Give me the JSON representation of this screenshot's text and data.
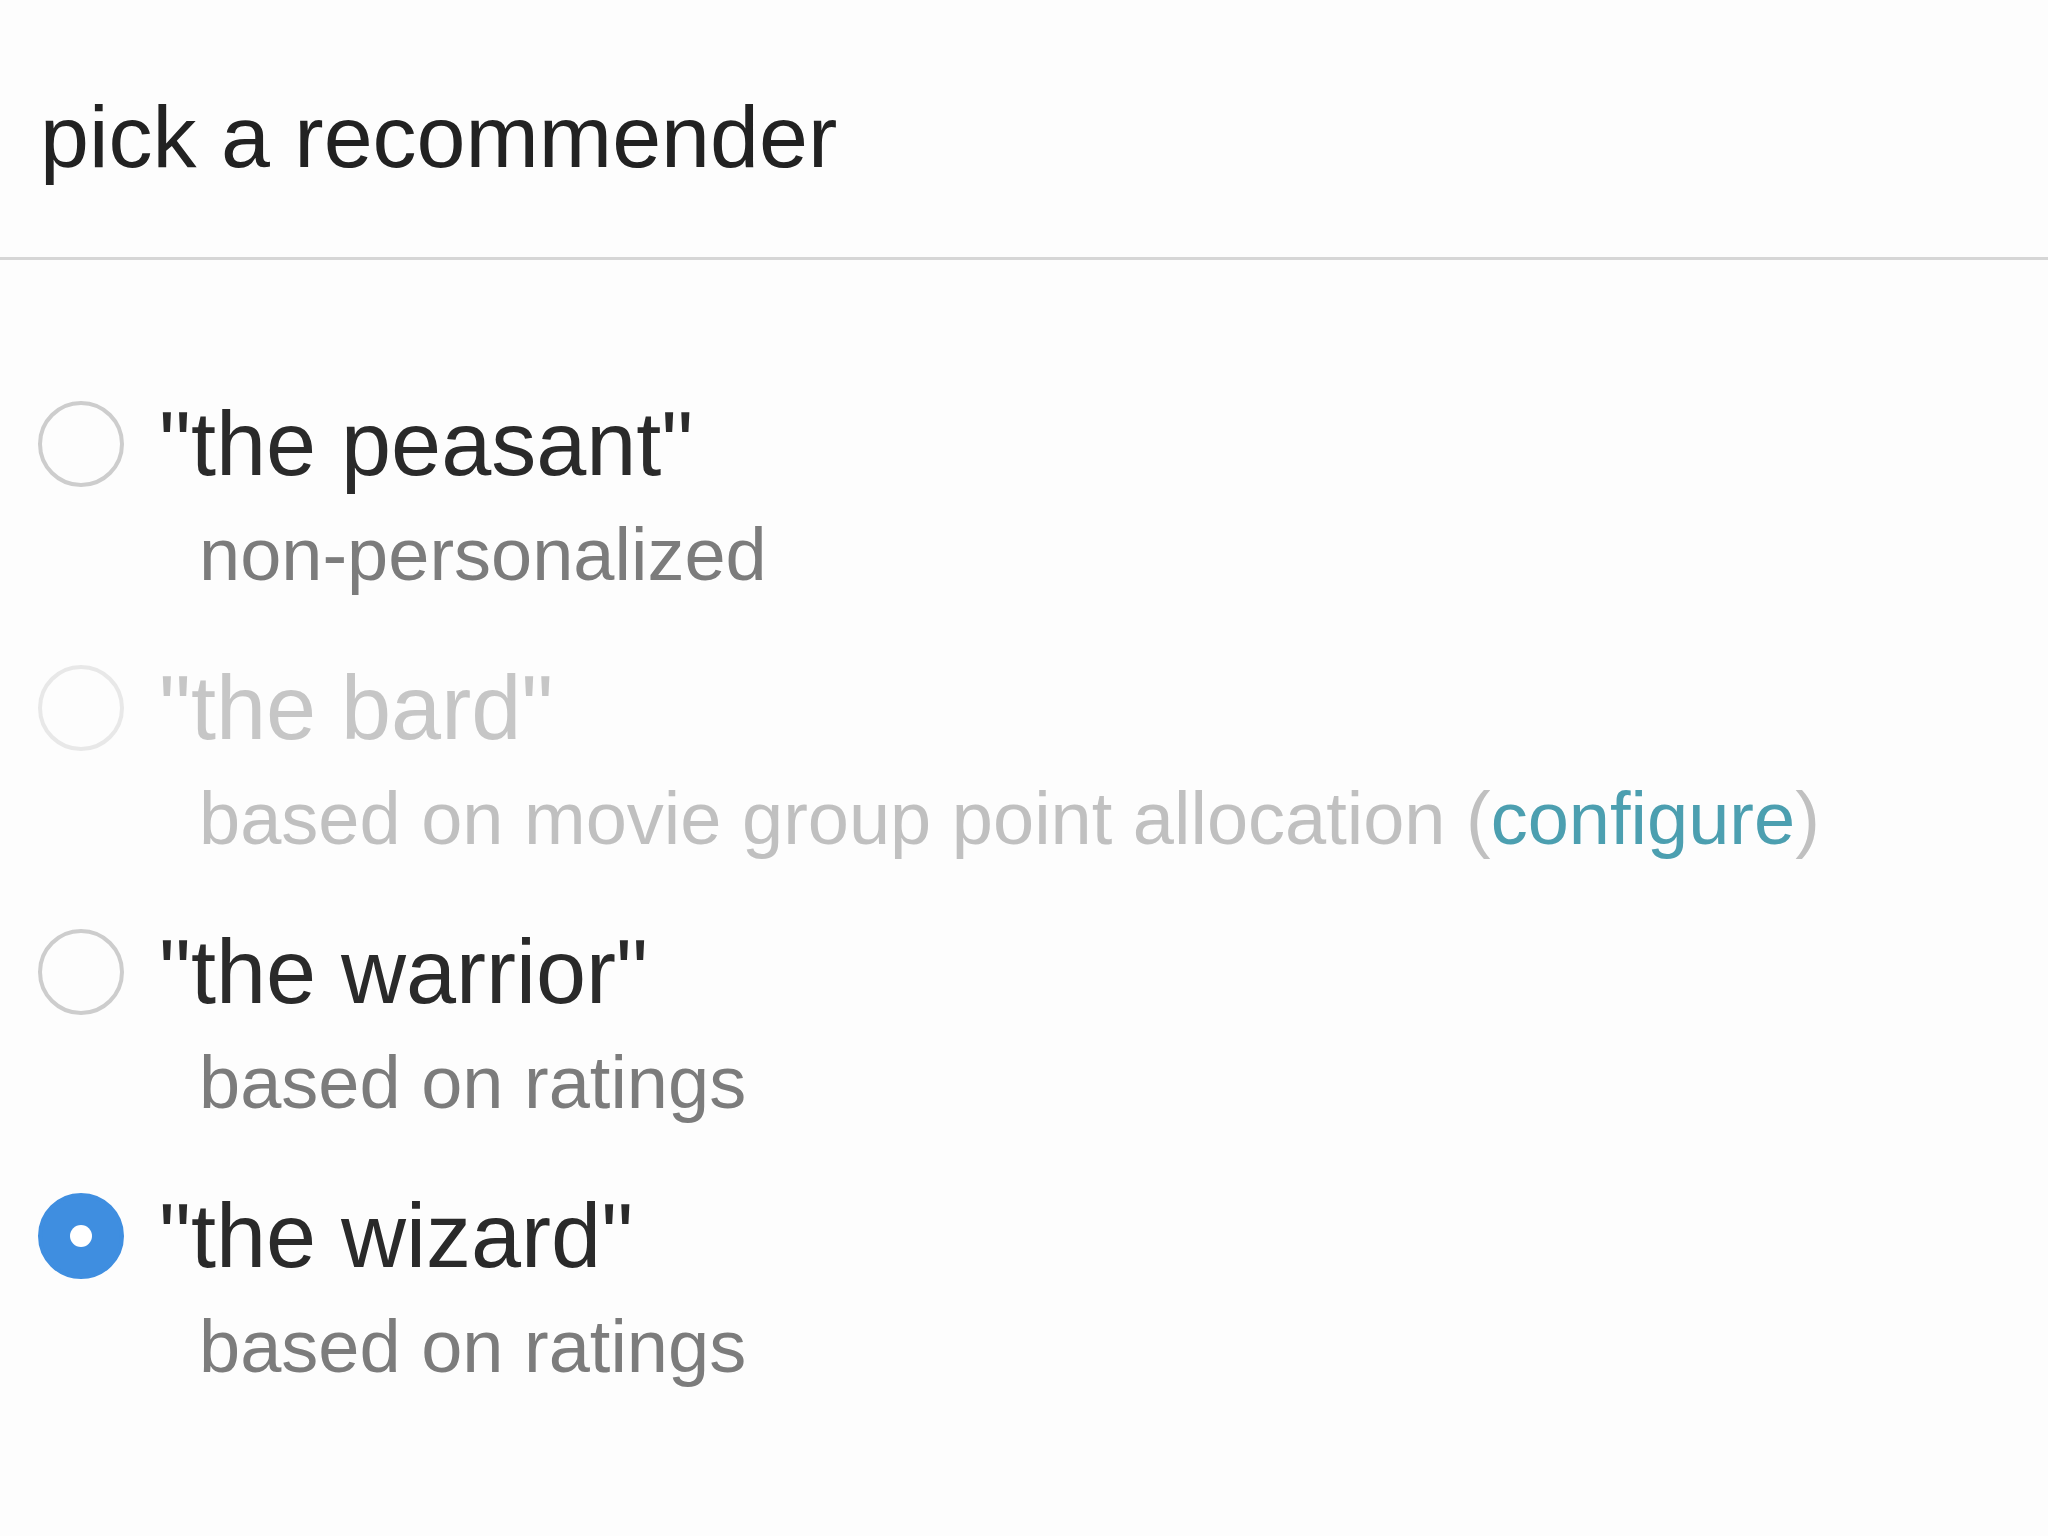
{
  "title": "pick a recommender",
  "options": [
    {
      "label": "\"the peasant\"",
      "description": [
        {
          "kind": "text",
          "text": "non-personalized"
        }
      ],
      "selected": false,
      "disabled": false
    },
    {
      "label": "\"the bard\"",
      "description": [
        {
          "kind": "text",
          "text": "based on movie group point allocation ("
        },
        {
          "kind": "link",
          "text": "configure"
        },
        {
          "kind": "text",
          "text": ")"
        }
      ],
      "selected": false,
      "disabled": true
    },
    {
      "label": "\"the warrior\"",
      "description": [
        {
          "kind": "text",
          "text": "based on ratings"
        }
      ],
      "selected": false,
      "disabled": false
    },
    {
      "label": "\"the wizard\"",
      "description": [
        {
          "kind": "text",
          "text": "based on ratings"
        }
      ],
      "selected": true,
      "disabled": false
    }
  ]
}
